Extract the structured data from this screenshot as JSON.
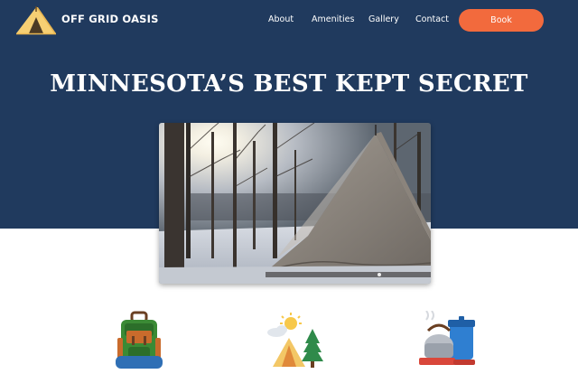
{
  "brand": {
    "name": "OFF GRID OASIS",
    "logo_icon": "tent-logo-icon"
  },
  "nav": {
    "items": [
      {
        "label": "About"
      },
      {
        "label": "Amenities"
      },
      {
        "label": "Gallery"
      },
      {
        "label": "Contact"
      }
    ],
    "book_label": "Book"
  },
  "hero": {
    "headline": "MINNESOTA’S BEST KEPT SECRET",
    "photo_subject": "canvas bell tent in snowy woods at sunset"
  },
  "amenities": [
    {
      "icon": "backpack-icon"
    },
    {
      "icon": "tent-campsite-icon"
    },
    {
      "icon": "cooking-pot-icon"
    }
  ],
  "colors": {
    "hero_background": "#203a5e",
    "accent": "#f26a3d",
    "text_light": "#ffffff",
    "page_background": "#ffffff"
  }
}
